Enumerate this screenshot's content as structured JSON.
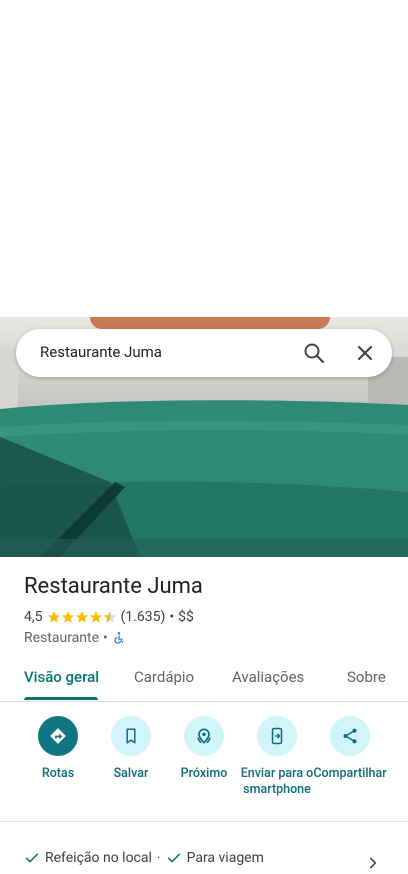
{
  "search": {
    "query": "Restaurante Juma"
  },
  "place": {
    "name": "Restaurante Juma",
    "rating": "4,5",
    "stars": 4.5,
    "reviews": "(1.635)",
    "sep1": "•",
    "price": "$$",
    "category": "Restaurante",
    "sep2": "•"
  },
  "tabs": [
    {
      "label": "Visão geral"
    },
    {
      "label": "Cardápio"
    },
    {
      "label": "Avaliações"
    },
    {
      "label": "Sobre"
    }
  ],
  "actions": [
    {
      "label": "Rotas",
      "icon": "directions-icon"
    },
    {
      "label": "Salvar",
      "icon": "bookmark-icon"
    },
    {
      "label": "Próximo",
      "icon": "nearby-icon"
    },
    {
      "label": "Enviar para o smartphone",
      "icon": "send-to-phone-icon"
    },
    {
      "label": "Compartilhar",
      "icon": "share-icon"
    }
  ],
  "services": {
    "item1": "Refeição no local",
    "sep": "·",
    "item2": "Para viagem"
  },
  "colors": {
    "accent": "#00796b",
    "action_bg": "#d2f5fb",
    "star": "#fbbc04"
  }
}
